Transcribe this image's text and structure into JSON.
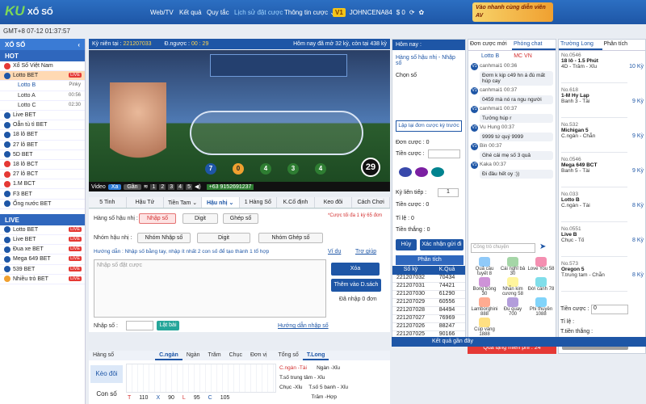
{
  "header": {
    "logo": "KU",
    "logo_sub": "XỔ SỐ",
    "nav": [
      "Web/TV",
      "Kết quả",
      "Quy tắc",
      "Lịch sử đặt cược",
      "Thông tin cược ⌄"
    ],
    "vip": "V1",
    "username": "JOHNCENA84",
    "balance": "$ 0",
    "promo": "Vào nhanh cùng diễn viên AV"
  },
  "gmt": "GMT+8 07-12 01:37:57",
  "sidebar": {
    "title": "XỔ SỐ",
    "hot": "HOT",
    "hot_items": [
      "Xổ Số Việt Nam",
      "Lotto BET",
      "Lotto B",
      "Lotto A",
      "Lotto C",
      "Live BET",
      "Oẳn tù tì BET",
      "18 lô BET",
      "27 lô BET",
      "5D BET",
      "18 lô BCT",
      "27 lô BCT",
      "1.M BCT",
      "F3 BET",
      "Ống nước BET"
    ],
    "times": {
      "b": "Pinky",
      "a": "00:56",
      "c": "02:30"
    },
    "live_label": "LIVE",
    "live_head": "LIVE",
    "live_items": [
      "Lotto BET",
      "Live BET",
      "Đua xe BET",
      "Mega 649 BET",
      "539 BET",
      "Nhiều trò BET"
    ]
  },
  "game": {
    "period_label": "Kỳ niên tại :",
    "period": "221207033",
    "countdown_label": "Đ.ngược :",
    "countdown": "00 : 29",
    "today": "Hôm nay đã mở 32 kỳ, còn tại 438 kỳ",
    "balls": [
      "7",
      "0",
      "4",
      "3",
      "4"
    ],
    "remain": "29",
    "phone": "+63 9152691237",
    "video_label": "Video",
    "btn_xa": "Xa",
    "btn_gan": "Gần",
    "nums": [
      "1",
      "2",
      "3",
      "4",
      "5"
    ]
  },
  "tabs": [
    "5 Tinh",
    "Hậu Tứ",
    "Tiền Tam ⌄",
    "Hậu nhị ⌄",
    "1 Hàng Số",
    "K.Cố định",
    "Keo đôi",
    "Cách Chơi"
  ],
  "form": {
    "label1": "Hàng số hậu nhị :",
    "opt1": "Nhập số",
    "opt2": "Digit",
    "opt3": "Ghép số",
    "note": "*Cược tối đa 1 kỳ 65 đơn",
    "label2": "Nhóm hậu nhị :",
    "g1": "Nhóm Nhập số",
    "g2": "Digit",
    "g3": "Nhóm Ghép số",
    "guide": "Hướng dẫn : Nhập số bằng tay, nhập ít nhất 2 con số để tạo thành 1 tổ hợp",
    "vidu": "Ví dụ",
    "help": "Trợ giúp",
    "placeholder": "Nhập số đặt cược",
    "btn_del": "Xóa",
    "btn_add": "Thêm vào D.sách",
    "count": "Đã nhập 0 đơn",
    "input_label": "Nhập số :",
    "btn_flip": "Lật bài",
    "guide2": "Hướng dẫn nhập số"
  },
  "bottom": {
    "tabs": [
      "Hàng số",
      "C.ngàn",
      "Ngàn",
      "Trăm",
      "Chục",
      "Đơn vị"
    ],
    "tabs2": [
      "Tổng số",
      "T.Long",
      "Sút",
      "T.Số",
      "Hàm tam",
      "Trung tam",
      "Hậu tam"
    ],
    "row_label1": "Kèo đôi",
    "row_label2": "Con số",
    "stats": [
      "T",
      "110",
      "X",
      "90",
      "L",
      "95",
      "C",
      "105"
    ],
    "lines": [
      "C.ngàn -Tài",
      "T.số trung tâm - Xỉu",
      "Chục -Xỉu",
      "Ngàn -Xỉu",
      "T.số 5 banh - Xỉu",
      "Trăm -Hợp",
      "Chục -Tố",
      "Rồng Hổ - Rồng",
      "Hàm tam -Tố"
    ],
    "ky": [
      "4 Kỳ",
      "4 Kỳ",
      "3 Kỳ"
    ]
  },
  "mid": {
    "title": "Hôm nay :",
    "sub": "Hàng số hậu nhị - Nhập số",
    "chon": "Chọn số",
    "btn_relay": "Lập lại đơn cược kỳ trước",
    "don_cuoc": "Đơn cược : 0",
    "tien_cuoc": "Tiền cược :",
    "ky_tiep": "Kỳ liên tiếp :",
    "ky_val": "1",
    "tien_cuoc2": "Tiền cược : 0",
    "ti_le": "Tỉ lệ : 0",
    "tien_thang": "Tiền thắng : 0",
    "btn_huy": "Hủy",
    "btn_ok": "Xác nhận gửi đi",
    "phan_tich": "Phân tích",
    "cols": [
      "Số kỳ",
      "K.Quả"
    ],
    "rows": [
      [
        "221207032",
        "70434"
      ],
      [
        "221207031",
        "74421"
      ],
      [
        "221207030",
        "61290"
      ],
      [
        "221207029",
        "60556"
      ],
      [
        "221207028",
        "84494"
      ],
      [
        "221207027",
        "76969"
      ],
      [
        "221207026",
        "88247"
      ],
      [
        "221207025",
        "90166"
      ]
    ]
  },
  "chat": {
    "tab1": "Đơn cược mới",
    "tab2": "Phòng chat",
    "lottob": "Lotto B",
    "mcvn": "MC VN",
    "msgs": [
      {
        "u": "canhmai1",
        "t": "00:36",
        "m": "Đơm k kịp c49 hn á đù mất húp cay"
      },
      {
        "u": "canhmai1",
        "t": "00:37",
        "m": "0459 mà nó ra ngu người"
      },
      {
        "u": "canhmai1",
        "t": "00:37",
        "m": "Tưởng húp r"
      },
      {
        "u": "Vu Hung",
        "t": "00:37",
        "m": "9999 tứ quý 9999"
      },
      {
        "u": "Bin",
        "t": "00:37",
        "m": "Ghé cái mẹ số 3 quả"
      },
      {
        "u": "Kaka",
        "t": "00:37",
        "m": "Đi đâu hết oy :))"
      }
    ],
    "input_ph": "Công trò chuyện",
    "gifts": [
      "Quả cầu tuyết 8",
      "Cái nghỉ bả 30",
      "Love You 58",
      "Bong bóng 30",
      "Nhẫn kim cương 58",
      "Đời cánh 78",
      "Lamborghini 888",
      "Đu quay 700",
      "Phi thuyền 1088",
      "Cúp vàng 1888"
    ],
    "redbar": "Quà tặng miễn phí : 24"
  },
  "results_title": "Kết quả gần đây",
  "right": {
    "tab1": "Trường Long",
    "tab2": "Phân tích",
    "cards": [
      {
        "no": "No.0546",
        "nm": "18 lô - 1.5 Phút",
        "sub": "4D - Trăm - Xỉu",
        "k": "10 Kỳ"
      },
      {
        "no": "No.618",
        "nm": "1-M Hy Lạp",
        "sub": "Banh 3 - Tài",
        "k": "9 Kỳ"
      },
      {
        "no": "No.532",
        "nm": "Michigan 5",
        "sub": "C.ngàn - Chẵn",
        "k": "9 Kỳ"
      },
      {
        "no": "No.0546",
        "nm": "Mega 649 BCT",
        "sub": "Banh 5 - Tài",
        "k": "9 Kỳ"
      },
      {
        "no": "No.033",
        "nm": "Lotto B",
        "sub": "C.ngàn - Tài",
        "k": "8 Kỳ"
      },
      {
        "no": "No.0551",
        "nm": "Live B",
        "sub": "Chục - Tố",
        "k": "8 Kỳ"
      },
      {
        "no": "No.573",
        "nm": "Oregon 5",
        "sub": "T.trung tam - Chẵn",
        "k": "8 Kỳ"
      }
    ],
    "tien_cuoc": "Tiền cược :",
    "val": "0",
    "ti_le": "Tỉ lệ :",
    "tien_thang": "T.tiền thắng :",
    "btn": "Hủy"
  }
}
